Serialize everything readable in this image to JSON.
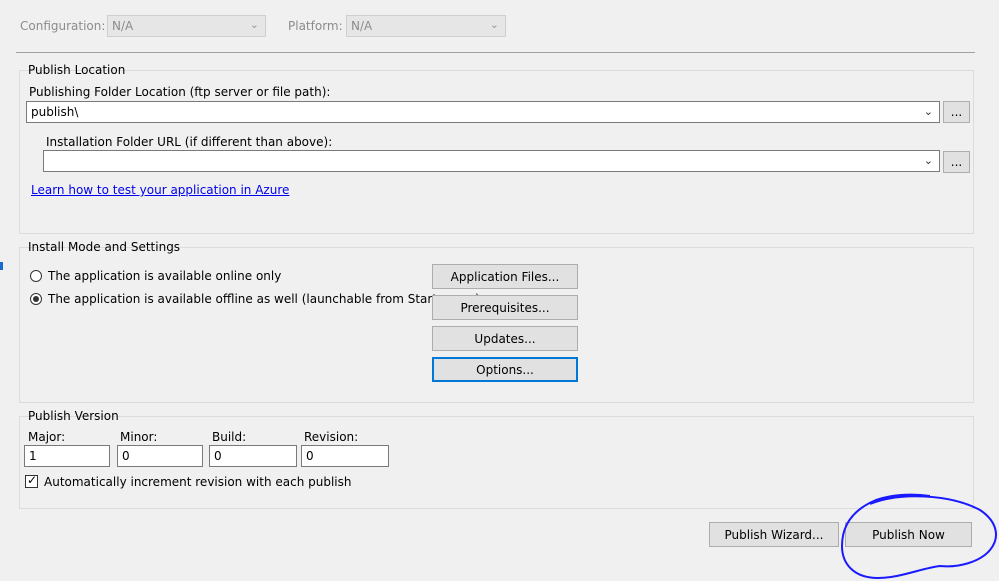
{
  "top": {
    "configuration_label": "Configuration:",
    "configuration_value": "N/A",
    "platform_label": "Platform:",
    "platform_value": "N/A"
  },
  "publish_location": {
    "title": "Publish Location",
    "folder_label": "Publishing Folder Location (ftp server or file path):",
    "folder_value": "publish\\",
    "browse_label": "...",
    "install_url_label": "Installation Folder URL (if different than above):",
    "install_url_value": "",
    "install_browse_label": "...",
    "azure_link": "Learn how to test your application in Azure"
  },
  "install_mode": {
    "title": "Install Mode and Settings",
    "option_online": "The application is available online only",
    "option_offline": "The application is available offline as well (launchable from Start menu)",
    "selected": "offline",
    "buttons": {
      "app_files": "Application Files...",
      "prerequisites": "Prerequisites...",
      "updates": "Updates...",
      "options": "Options..."
    }
  },
  "publish_version": {
    "title": "Publish Version",
    "major_label": "Major:",
    "major_value": "1",
    "minor_label": "Minor:",
    "minor_value": "0",
    "build_label": "Build:",
    "build_value": "0",
    "revision_label": "Revision:",
    "revision_value": "0",
    "auto_increment_label": "Automatically increment revision with each publish",
    "auto_increment_checked": true
  },
  "footer": {
    "wizard_label": "Publish Wizard...",
    "publish_now_label": "Publish Now"
  },
  "colors": {
    "annotation": "#1a1aff",
    "focus": "#0078d7"
  }
}
